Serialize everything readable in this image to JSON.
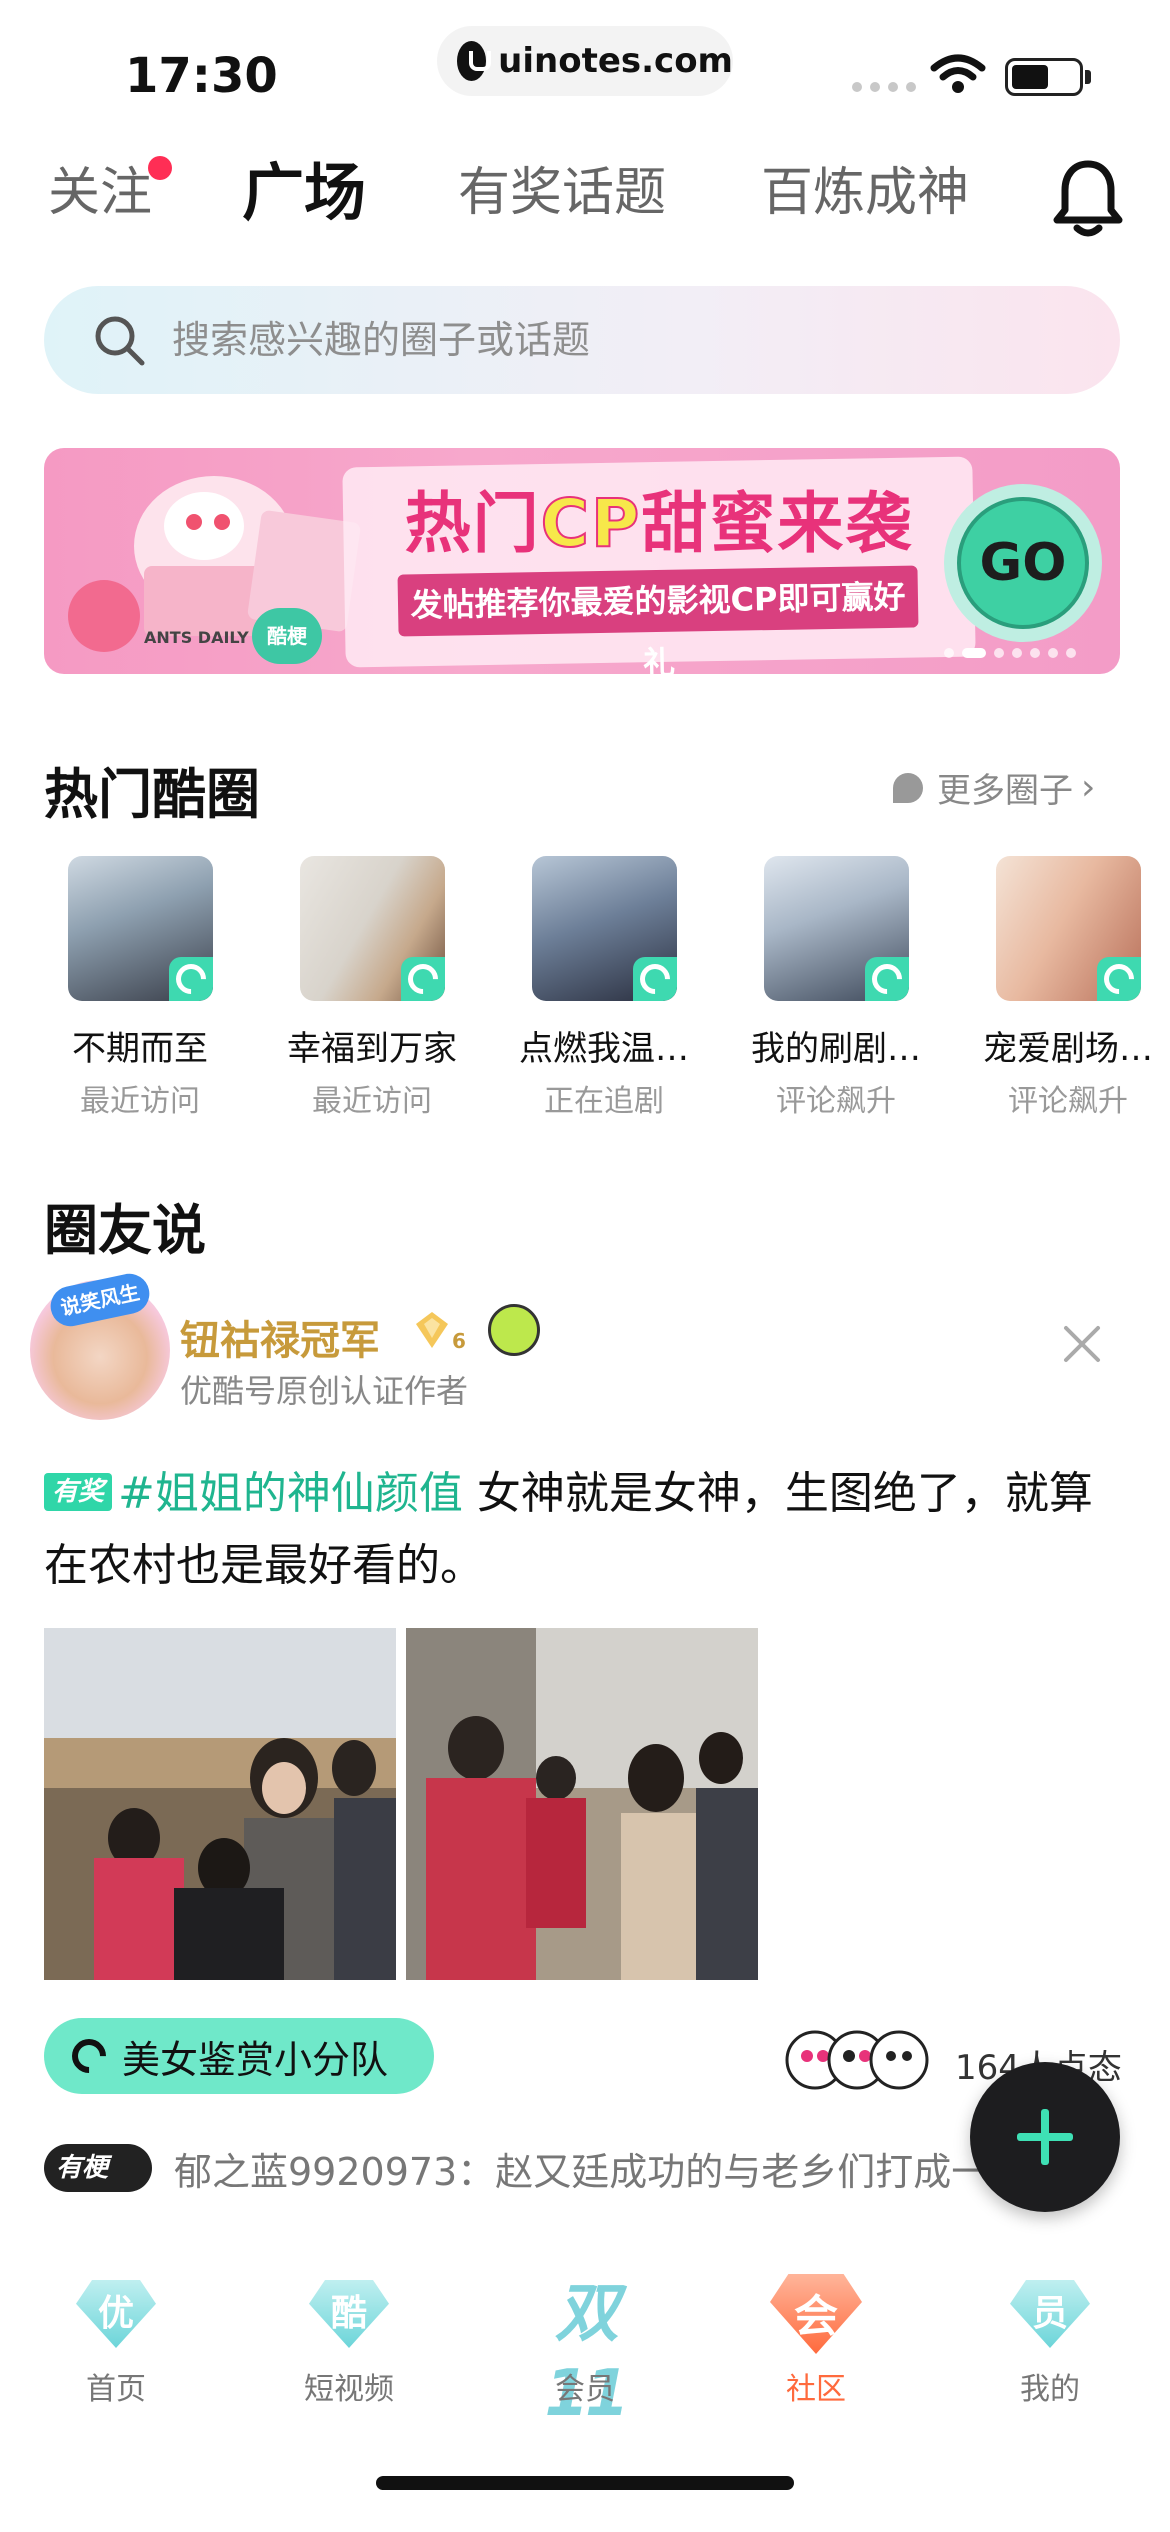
{
  "status_bar": {
    "time": "17:30",
    "url": "uinotes.com"
  },
  "top_tabs": [
    {
      "label": "关注",
      "active": false,
      "has_dot": true
    },
    {
      "label": "广场",
      "active": true
    },
    {
      "label": "有奖话题",
      "active": false
    },
    {
      "label": "百炼成神",
      "active": false
    }
  ],
  "search": {
    "placeholder": "搜索感兴趣的圈子或话题"
  },
  "banner": {
    "title_pre": "热门",
    "title_cp": "CP",
    "title_post": "甜蜜来袭",
    "subtitle": "发帖推荐你最爱的影视CP即可赢好礼",
    "tag": "酷梗",
    "small_text": "ANTS DAILY",
    "go_label": "GO",
    "page_count": 7,
    "active_page": 1
  },
  "hot_circles": {
    "title": "热门酷圈",
    "more_label": "更多圈子",
    "items": [
      {
        "name": "不期而至",
        "status": "最近访问"
      },
      {
        "name": "幸福到万家",
        "status": "最近访问"
      },
      {
        "name": "点燃我温…",
        "status": "正在追剧"
      },
      {
        "name": "我的刷剧…",
        "status": "评论飙升"
      },
      {
        "name": "宠爱剧场…",
        "status": "评论飙升"
      }
    ]
  },
  "feed": {
    "title": "圈友说",
    "post": {
      "avatar_badge": "说笑风生",
      "author": "钮祜禄冠军",
      "level": "6",
      "author_sub": "优酷号原创认证作者",
      "reward_tag": "有奖",
      "hashtag": "#姐姐的神仙颜值",
      "text": " 女神就是女神，生图绝了，就算在农村也是最好看的。",
      "group": "美女鉴赏小分队",
      "activity": "164人点态",
      "comment_tag": "有梗",
      "comment": "郁之蓝9920973：赵又廷成功的与老乡们打成一片"
    }
  },
  "bottom_nav": [
    {
      "label": "首页",
      "char": "优",
      "active": false
    },
    {
      "label": "短视频",
      "char": "酷",
      "active": false
    },
    {
      "label": "会员",
      "char": "双11",
      "active": false
    },
    {
      "label": "社区",
      "char": "会",
      "active": true
    },
    {
      "label": "我的",
      "char": "员",
      "active": false
    }
  ],
  "colors": {
    "accent_green": "#2fd6a8",
    "hashtag": "#1fb58f",
    "author_gold": "#c79a3b",
    "nav_active": "#ff6a3d",
    "tab_dot": "#ff2e55"
  }
}
